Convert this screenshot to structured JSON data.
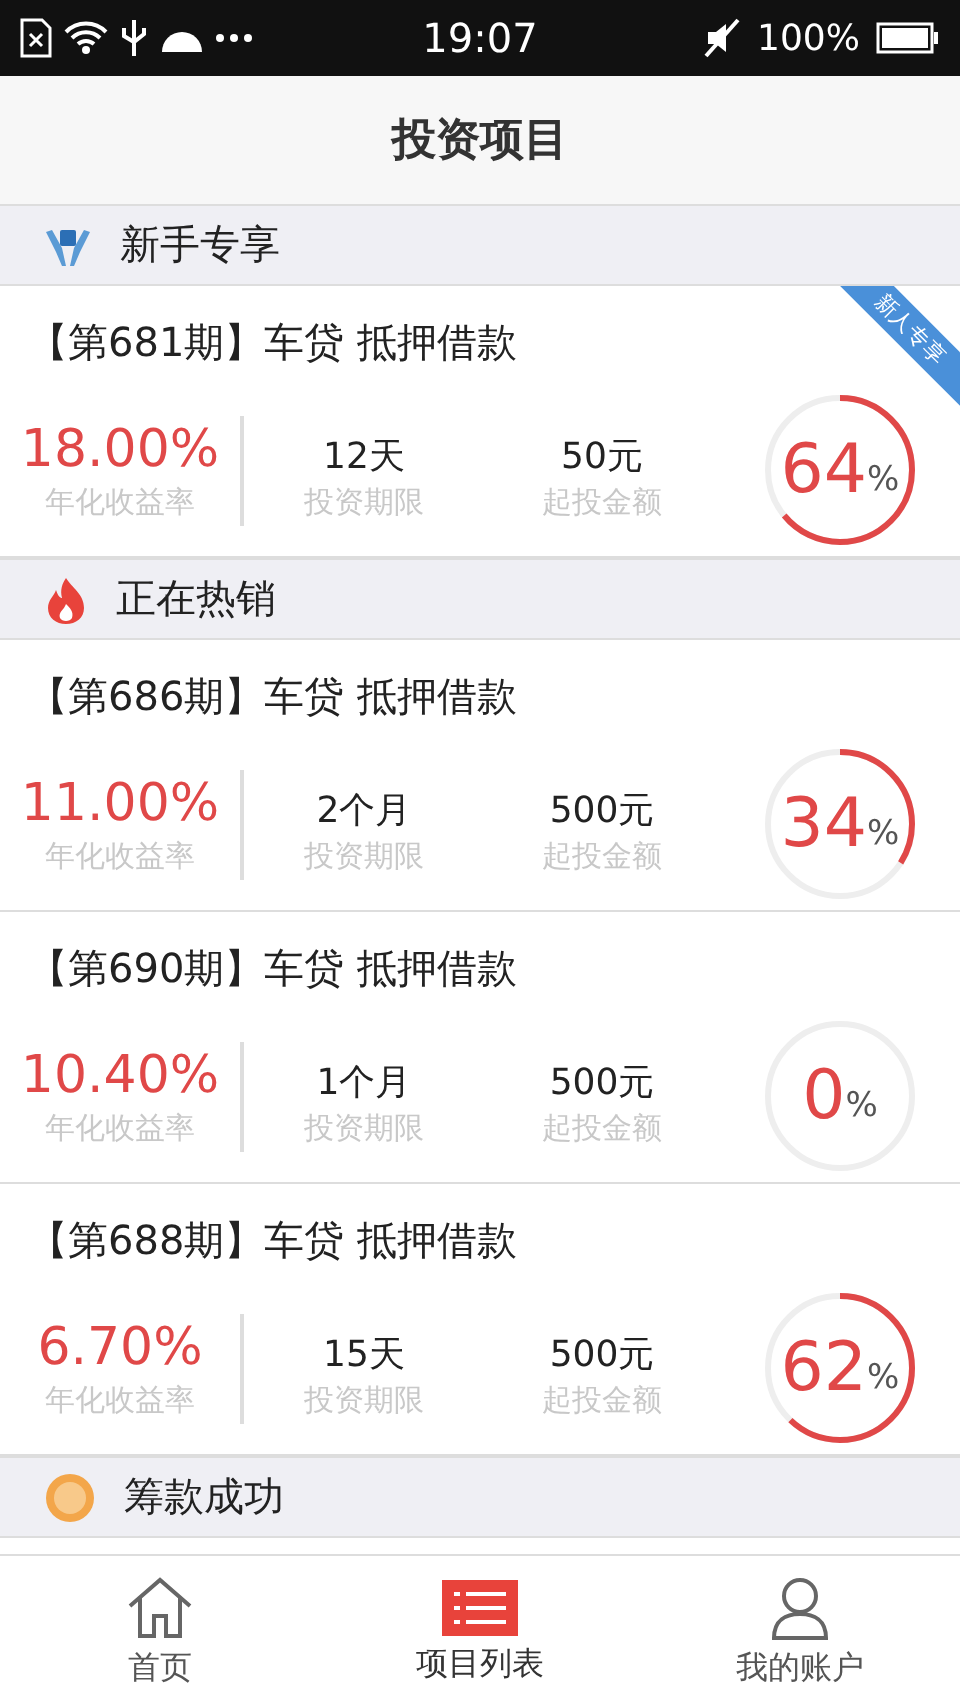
{
  "status_bar": {
    "time": "19:07",
    "battery": "100%"
  },
  "header": {
    "title": "投资项目"
  },
  "sections": [
    {
      "title": "新手专享",
      "items": [
        {
          "title": "【第681期】车贷 抵押借款",
          "rate": "18.00%",
          "rate_label": "年化收益率",
          "term": "12天",
          "term_label": "投资期限",
          "min": "50元",
          "min_label": "起投金额",
          "progress": "64",
          "unit": "%",
          "ribbon": "新人专享"
        }
      ]
    },
    {
      "title": "正在热销",
      "items": [
        {
          "title": "【第686期】车贷 抵押借款",
          "rate": "11.00%",
          "rate_label": "年化收益率",
          "term": "2个月",
          "term_label": "投资期限",
          "min": "500元",
          "min_label": "起投金额",
          "progress": "34",
          "unit": "%"
        },
        {
          "title": "【第690期】车贷 抵押借款",
          "rate": "10.40%",
          "rate_label": "年化收益率",
          "term": "1个月",
          "term_label": "投资期限",
          "min": "500元",
          "min_label": "起投金额",
          "progress": "0",
          "unit": "%"
        },
        {
          "title": "【第688期】车贷 抵押借款",
          "rate": "6.70%",
          "rate_label": "年化收益率",
          "term": "15天",
          "term_label": "投资期限",
          "min": "500元",
          "min_label": "起投金额",
          "progress": "62",
          "unit": "%"
        }
      ]
    },
    {
      "title": "筹款成功"
    }
  ],
  "tabs": [
    {
      "label": "首页",
      "selected": false
    },
    {
      "label": "项目列表",
      "selected": true
    },
    {
      "label": "我的账户",
      "selected": false
    }
  ]
}
